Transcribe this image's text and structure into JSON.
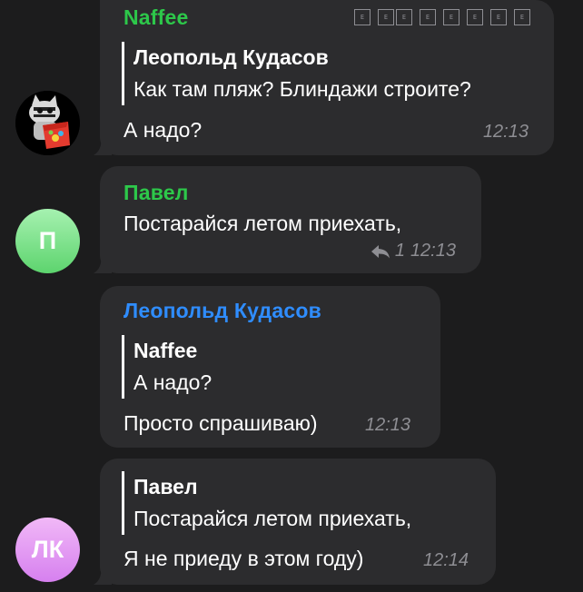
{
  "messages": [
    {
      "sender": "Naffee",
      "quote_author": "Леопольд Кудасов",
      "quote_text": "Как там пляж? Блиндажи строите?",
      "text": "А надо?",
      "time": "12:13",
      "reactions": [
        "E",
        "E",
        "E",
        "E",
        "E",
        "E",
        "E",
        "E"
      ]
    },
    {
      "sender": "Павел",
      "avatar_initials": "П",
      "text": "Постарайся летом приехать,",
      "reply_count": "1",
      "time": "12:13"
    },
    {
      "sender": "Леопольд Кудасов",
      "quote_author": "Naffee",
      "quote_text": "А надо?",
      "text": "Просто спрашиваю)",
      "time": "12:13"
    },
    {
      "avatar_initials": "ЛК",
      "quote_author": "Павел",
      "quote_text": "Постарайся летом приехать,",
      "text": "Я не приеду в этом году)",
      "time": "12:14"
    }
  ],
  "colors": {
    "background": "#1c1c1d",
    "bubble": "#2c2c2e",
    "sender_green": "#2dc84a",
    "sender_blue": "#2f8dff",
    "meta_gray": "#8e8e93"
  }
}
